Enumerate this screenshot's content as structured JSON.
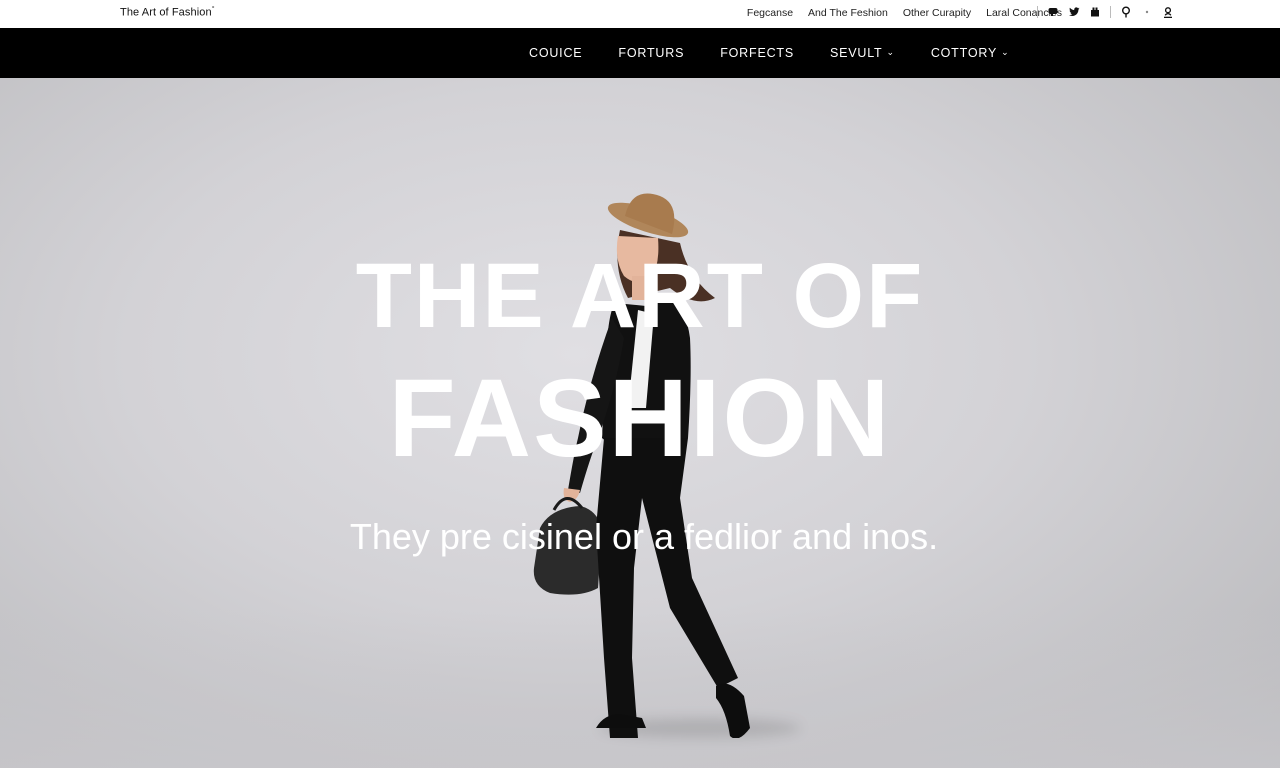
{
  "brand": {
    "name": "The Art of Fashion",
    "mark": "°"
  },
  "utility_links": [
    "Fegcanse",
    "And The Feshion",
    "Other Curapity",
    "Laral Conancles"
  ],
  "utility_icons": [
    "chat-icon",
    "twitter-icon",
    "share-icon",
    "search-icon",
    "user-icon"
  ],
  "nav": {
    "items": [
      {
        "label": "COUICE",
        "dropdown": false
      },
      {
        "label": "FORTURS",
        "dropdown": false
      },
      {
        "label": "FORFECTS",
        "dropdown": false
      },
      {
        "label": "SEVULT",
        "dropdown": true
      },
      {
        "label": "COTTORY",
        "dropdown": true
      }
    ],
    "chevron": "⌄"
  },
  "hero": {
    "headline_line1": "THE ART OF",
    "headline_line2": "FASHION",
    "tagline": "They pre cisinel or a  fedlior and inos."
  },
  "colors": {
    "nav_bg": "#000000",
    "hero_bg": "#d6d5d9",
    "headline": "#ffffff"
  }
}
